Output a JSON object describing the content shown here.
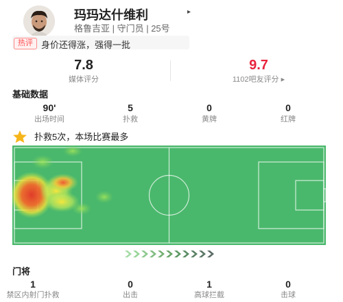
{
  "player": {
    "name": "玛玛达什维利",
    "name_arrow": "▸",
    "info": "格鲁吉亚 | 守门员 | 25号",
    "hot_badge": "热评",
    "hot_comment": "身价还得涨，强得一批"
  },
  "ratings": {
    "media_score": "7.8",
    "media_label": "媒体评分",
    "fan_score": "9.7",
    "fan_label": "1102吧友评分 ▸",
    "fan_color": "#e8253e"
  },
  "basic_stats": {
    "title": "基础数据",
    "items": [
      {
        "value": "90'",
        "label": "出场时间"
      },
      {
        "value": "5",
        "label": "扑救"
      },
      {
        "value": "0",
        "label": "黄牌"
      },
      {
        "value": "0",
        "label": "红牌"
      }
    ]
  },
  "highlight": {
    "icon": "star-icon",
    "text": "扑救5次，本场比赛最多"
  },
  "heatmap": {
    "pitch_color": "#4ab86c"
  },
  "goalkeeper_stats": {
    "title": "门将",
    "items": [
      {
        "value": "1",
        "label": "禁区内射门扑救"
      },
      {
        "value": "0",
        "label": "出击"
      },
      {
        "value": "1",
        "label": "高球拦截"
      },
      {
        "value": "0",
        "label": "击球"
      }
    ]
  }
}
